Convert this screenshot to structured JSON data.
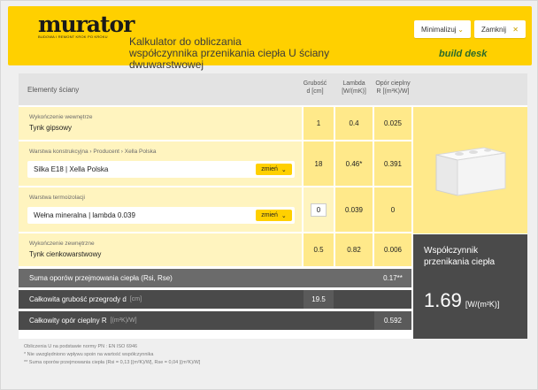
{
  "header": {
    "logo": "murator",
    "logo_tagline": "Budowa i remont krok po kroku",
    "title_line1": "Kalkulator do obliczania",
    "title_line2": "współczynnika przenikania ciepła U ściany dwuwarstwowej",
    "minimize_label": "Minimalizuj",
    "close_label": "Zamknij",
    "brand_right": "build desk"
  },
  "table": {
    "elements_header": "Elementy ściany",
    "col_thickness": [
      "Grubość",
      "d [cm]"
    ],
    "col_lambda": [
      "Lambda",
      "[W/(mK)]"
    ],
    "col_resistance": [
      "Opór cieplny",
      "R [(m²K)/W]"
    ]
  },
  "rows": {
    "inner": {
      "sub": "Wykończenie wewnętrze",
      "main": "Tynk gipsowy",
      "d": "1",
      "lambda": "0.4",
      "r": "0.025"
    },
    "structural": {
      "sub": "Warstwa konstrukcyjna  ›  Producent  ›  Xella Polska",
      "input": "Silka E18 | Xella Polska",
      "change": "zmień",
      "d": "18",
      "lambda": "0.46*",
      "r": "0.391"
    },
    "insulation": {
      "sub": "Warstwa termoizolacji",
      "input": "Wełna mineralna | lambda 0.039",
      "change": "zmień",
      "d": "0",
      "lambda": "0.039",
      "r": "0"
    },
    "outer": {
      "sub": "Wykończenie zewnętrzne",
      "main": "Tynk cienkowarstwowy",
      "d": "0.5",
      "lambda": "0.82",
      "r": "0.006"
    }
  },
  "summary": {
    "rsi_label": "Suma oporów przejmowania ciepła (Rsi, Rse)",
    "rsi_value": "0.17**",
    "thickness_label": "Całkowita grubość przegrody d",
    "thickness_unit": "[cm]",
    "thickness_value": "19.5",
    "resistance_label": "Całkowity opór cieplny R",
    "resistance_unit": "[(m²K)/W]",
    "resistance_value": "0.592"
  },
  "u_result": {
    "label": "Współczynnik przenikania ciepła",
    "value": "1.69",
    "unit": "[W/(m²K)]"
  },
  "notes": {
    "line1": "Obliczenia U na podstawie normy PN : EN ISO 6946",
    "line2": "*  Nie uwzględniono wpływu spoin na wartość współczynnika",
    "line3": "** Suma oporów przejmowania ciepła (Rsi = 0,13 [(m²K)/W], Rse = 0,04 [(m²K)/W]"
  }
}
